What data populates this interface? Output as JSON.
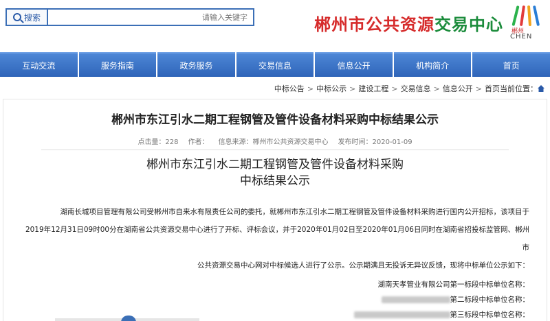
{
  "header": {
    "search_button": "搜索",
    "search_placeholder": "请输入关键字",
    "site_title_part1": "郴州市公共资源",
    "site_title_part2": "交易中心",
    "logo_cn": "郴州",
    "logo_en": "CHEN"
  },
  "nav": {
    "items": [
      "互动交流",
      "服务指南",
      "政务服务",
      "交易信息",
      "信息公开",
      "机构简介",
      "首页"
    ]
  },
  "breadcrumb": {
    "label": "当前位置：",
    "items": [
      "首页",
      "信息公开",
      "交易信息",
      "建设工程",
      "中标公示",
      "中标公告"
    ]
  },
  "article": {
    "title": "郴州市东江引水二期工程钢管及管件设备材料采购中标结果公示",
    "meta": {
      "publish_time": "发布时间：2020-01-09",
      "source": "信息来源：郴州市公共资源交易中心",
      "author": "作者：",
      "clicks": "点击量：228"
    },
    "subtitle_line1": "郴州市东江引水二期工程钢管及管件设备材料采购",
    "subtitle_line2": "中标结果公示",
    "body_line1": "湖南长城项目管理有限公司受郴州市自来水有限责任公司的委托，就郴州市东江引水二期工程钢管及管件设备材料采购进行国内公开招标，该项目于",
    "body_line2": "2019年12月31日09时00分在湖南省公共资源交易中心进行了开标、评标会议，并于2020年01月02日至2020年01月06日同时在湖南省招投标监管网、郴州市",
    "body_line3": "公共资源交易中心网对中标候选人进行了公示。公示期满且无投诉无异议反馈，现将中标单位公示如下：",
    "results": [
      {
        "label": "第一标段中标单位名称：",
        "value": "湖南天孝管业有限公司"
      },
      {
        "label": "第二标段中标单位名称：",
        "value": ""
      },
      {
        "label": "第三标段中标单位名称：",
        "value": ""
      }
    ]
  },
  "colors": {
    "nav_blue": "#2f65b9",
    "title_green": "#1c8c3c",
    "title_red": "#d62b2b"
  }
}
